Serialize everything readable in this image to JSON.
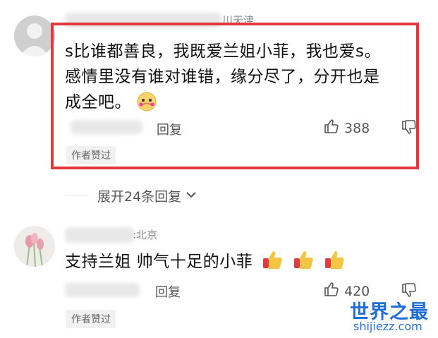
{
  "comment1": {
    "meta_partial": "川天津",
    "line1": "s比谁都善良，我既爱兰姐小菲，我也爱s。",
    "line2": "感情里没有谁对谁错，缘分尽了，分开也是",
    "line3": "成全吧。",
    "reply_label": "回复",
    "likes": "388",
    "badge": "作者赞过"
  },
  "expand": {
    "label": "展开24条回复"
  },
  "comment2": {
    "location": ":北京",
    "text": "支持兰姐 帅气十足的小菲",
    "reply_label": "回复",
    "likes": "420",
    "badge": "作者赞过"
  },
  "watermark": {
    "title": "世界之最",
    "url": "shijiezz.com"
  },
  "colors": {
    "highlight": "#e2373f",
    "watermark": "#1f6fd6"
  }
}
